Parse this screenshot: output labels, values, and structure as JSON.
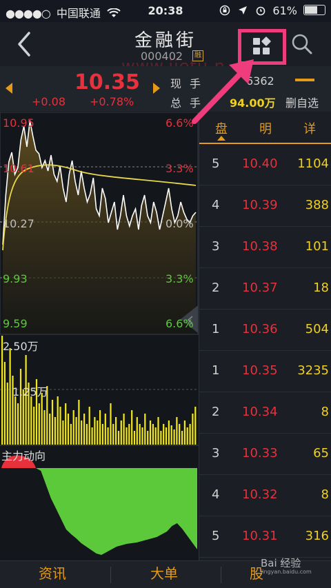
{
  "status": {
    "carrier": "中国联通",
    "time": "20:38",
    "battery": "61%",
    "signal_dots": "●●●●○"
  },
  "header": {
    "stock_name": "金融街",
    "stock_code": "000402",
    "margin_badge": "融",
    "watermark": "www.jietu.n"
  },
  "quote": {
    "last_price": "10.35",
    "change": "+0.08",
    "change_pct": "+0.78%",
    "current_volume_label": "现手",
    "current_volume": "6362",
    "total_volume_label": "总手",
    "total_volume": "94.00万",
    "remove_favorite": "删自选"
  },
  "chart": {
    "price_labels_left": [
      "10.95",
      "10.61",
      "10.27",
      "9.93",
      "9.59"
    ],
    "pct_labels_right": [
      "6.6%",
      "3.3%",
      "0.0%",
      "3.3%",
      "6.6%"
    ],
    "volume_labels": [
      "2.50万",
      "1.25万"
    ],
    "fund_flow_label": "主力动向",
    "colors": {
      "up": "#e8313c",
      "down": "#5cc93b",
      "avg_line": "#e8d84a",
      "price_line": "#ffffff",
      "volume": "#f2e81c"
    }
  },
  "order_book": {
    "tabs": [
      "盘",
      "明",
      "详"
    ],
    "asks": [
      {
        "level": "5",
        "price": "10.40",
        "qty": "1104"
      },
      {
        "level": "4",
        "price": "10.39",
        "qty": "388"
      },
      {
        "level": "3",
        "price": "10.38",
        "qty": "101"
      },
      {
        "level": "2",
        "price": "10.37",
        "qty": "18"
      },
      {
        "level": "1",
        "price": "10.36",
        "qty": "504"
      }
    ],
    "bids": [
      {
        "level": "1",
        "price": "10.35",
        "qty": "3235"
      },
      {
        "level": "2",
        "price": "10.34",
        "qty": "8"
      },
      {
        "level": "3",
        "price": "10.33",
        "qty": "65"
      },
      {
        "level": "4",
        "price": "10.32",
        "qty": "8"
      },
      {
        "level": "5",
        "price": "10.31",
        "qty": "316"
      }
    ]
  },
  "tab_bar": {
    "items": [
      "资讯",
      "大单",
      "股"
    ]
  },
  "baidu_watermark": {
    "logo": "Bai 经验",
    "url": "jingyan.baidu.com"
  }
}
